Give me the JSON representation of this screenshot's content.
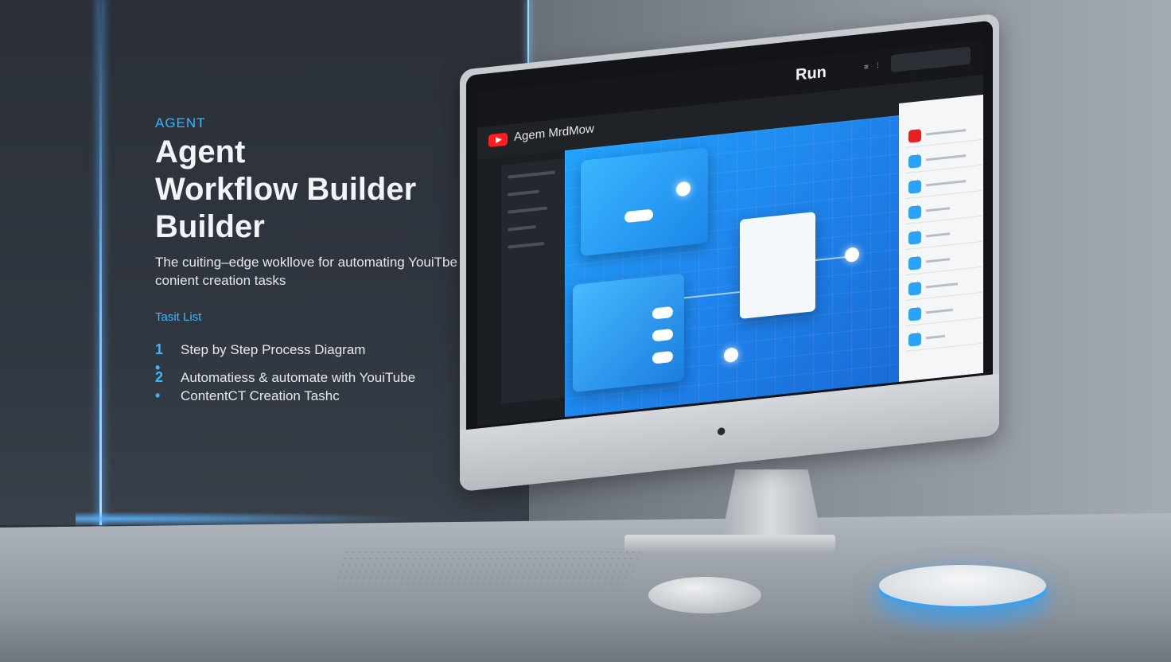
{
  "hero": {
    "eyebrow": "AGENT",
    "title_line1": "Agent",
    "title_line2": "Workflow Builder",
    "title_line3": "Builder",
    "subtitle": "The cuiting–edge wokllove for automating YouiTbe conient creation tasks",
    "task_list_label": "Tasit List",
    "tasks": [
      {
        "number": "1 •",
        "text": "Step by Step Process Diagram"
      },
      {
        "number": "2 •",
        "text": "Automatiess & automate with YouiTube ContentCT Creation Tashc"
      }
    ]
  },
  "screen": {
    "run_label": "Run",
    "app_name": "Agem MrdMow",
    "app_icon": "youtube-play-icon",
    "accent": "#1e8ff0"
  },
  "colors": {
    "accent_blue": "#39b7ff",
    "youtube_red": "#ff1f1f"
  }
}
